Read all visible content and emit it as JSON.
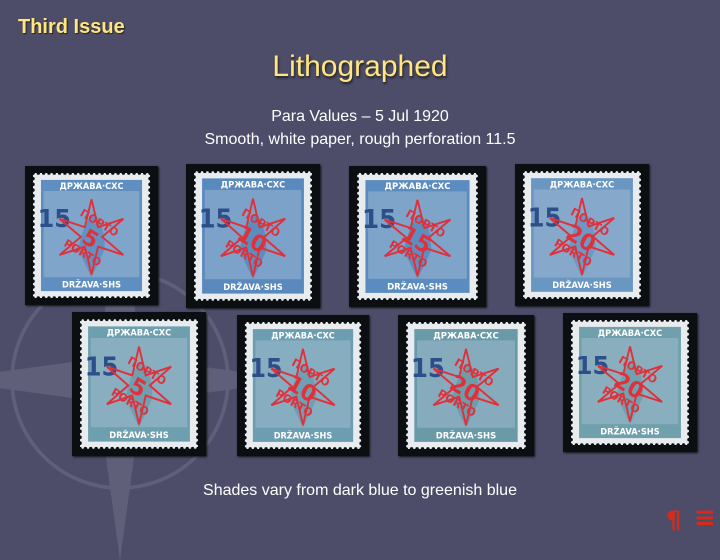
{
  "slide": {
    "section_title": "Third Issue",
    "title": "Lithographed",
    "subtitle_line1": "Para Values – 5 Jul 1920",
    "subtitle_line2": "Smooth, white paper, rough perforation 11.5",
    "caption": "Shades vary from dark blue to greenish blue"
  },
  "stamps": [
    {
      "top_text": "ДРЖАВА·СХС",
      "bottom_text": "DRŽAVA·SHS",
      "value": "15",
      "overprint_line1": "ПОРТО",
      "overprint_value": "5",
      "overprint_line2": "PORTO",
      "shade": "#5f8fc0"
    },
    {
      "top_text": "ДРЖАВА·СХС",
      "bottom_text": "DRŽAVA·SHS",
      "value": "15",
      "overprint_line1": "ПОРТО",
      "overprint_value": "10",
      "overprint_line2": "PORTO",
      "shade": "#5a89bd"
    },
    {
      "top_text": "ДРЖАВА·СХС",
      "bottom_text": "DRŽAVA·SHS",
      "value": "15",
      "overprint_line1": "ПОРТО",
      "overprint_value": "15",
      "overprint_line2": "PORTO",
      "shade": "#5b8cbf"
    },
    {
      "top_text": "ДРЖАВА·СХС",
      "bottom_text": "DRŽAVA·SHS",
      "value": "15",
      "overprint_line1": "ПОРТО",
      "overprint_value": "20",
      "overprint_line2": "PORTO",
      "shade": "#6a96c2"
    },
    {
      "top_text": "ДРЖАВА·СХС",
      "bottom_text": "DRŽAVA·SHS",
      "value": "15",
      "overprint_line1": "ПОРТО",
      "overprint_value": "5",
      "overprint_line2": "PORTO",
      "shade": "#6e9fae"
    },
    {
      "top_text": "ДРЖАВА·СХС",
      "bottom_text": "DRŽAVA·SHS",
      "value": "15",
      "overprint_line1": "ПОРТО",
      "overprint_value": "10",
      "overprint_line2": "PORTO",
      "shade": "#6c9db0"
    },
    {
      "top_text": "ДРЖАВА·СХС",
      "bottom_text": "DRŽAVA·SHS",
      "value": "15",
      "overprint_line1": "ПОРТО",
      "overprint_value": "20",
      "overprint_line2": "PORTO",
      "shade": "#6a9aa8"
    },
    {
      "top_text": "ДРЖАВА·СХС",
      "bottom_text": "DRŽAVA·SHS",
      "value": "15",
      "overprint_line1": "ПОРТО",
      "overprint_value": "20",
      "overprint_line2": "PORTO",
      "shade": "#6fa0ac"
    }
  ],
  "overprint_color": "#e0303a",
  "title_color": "#ffe680",
  "nav": {
    "pilcrow": "¶",
    "menu": "≡"
  }
}
